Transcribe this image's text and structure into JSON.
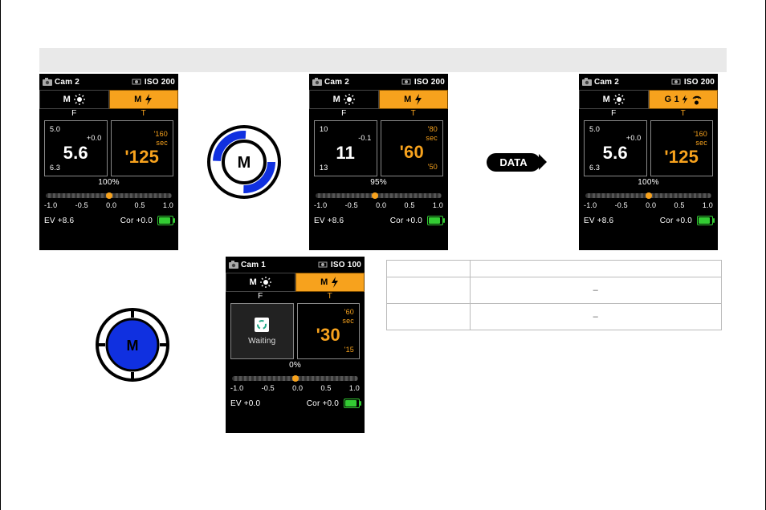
{
  "screens": {
    "a": {
      "cam": "Cam 2",
      "iso": "ISO  200",
      "modeL": "M",
      "modeR": "M",
      "F": "F",
      "T": "T",
      "Ft": "5.0",
      "Fv": "5.6",
      "Foff": "+0.0",
      "Fb": "6.3",
      "Tt": "'160",
      "Tv": "'125",
      "Tsec": "sec",
      "Tb": "",
      "pct": "100%",
      "ev": "EV  +8.6",
      "cor": "Cor +0.0"
    },
    "b": {
      "cam": "Cam 2",
      "iso": "ISO  200",
      "modeL": "M",
      "modeR": "M",
      "F": "F",
      "T": "T",
      "Ft": "10",
      "Fv": "11",
      "Foff": "-0.1",
      "Fb": "13",
      "Tt": "'80",
      "Tv": "'60",
      "Tsec": "sec",
      "Tb": "'50",
      "pct": "95%",
      "ev": "EV  +8.6",
      "cor": "Cor +0.0"
    },
    "c": {
      "cam": "Cam 2",
      "iso": "ISO  200",
      "modeL": "M",
      "modeR": "G 1",
      "F": "F",
      "T": "T",
      "Ft": "5.0",
      "Fv": "5.6",
      "Foff": "+0.0",
      "Fb": "6.3",
      "Tt": "'160",
      "Tv": "'125",
      "Tsec": "sec",
      "Tb": "",
      "pct": "100%",
      "ev": "EV  +8.6",
      "cor": "Cor +0.0"
    },
    "d": {
      "cam": "Cam 1",
      "iso": "ISO  100",
      "modeL": "M",
      "modeR": "M",
      "F": "F",
      "T": "T",
      "wait": "Waiting",
      "Tt": "'60",
      "Tv": "'30",
      "Tsec": "sec",
      "Tb": "'15",
      "pct": "0%",
      "ev": "EV  +0.0",
      "cor": "Cor +0.0"
    }
  },
  "scale": {
    "s1": "-1.0",
    "s2": "-0.5",
    "s3": "0.0",
    "s4": "0.5",
    "s5": "1.0"
  },
  "pill": "DATA",
  "dial": "M",
  "table": {
    "d1": "–",
    "d2": "–"
  }
}
